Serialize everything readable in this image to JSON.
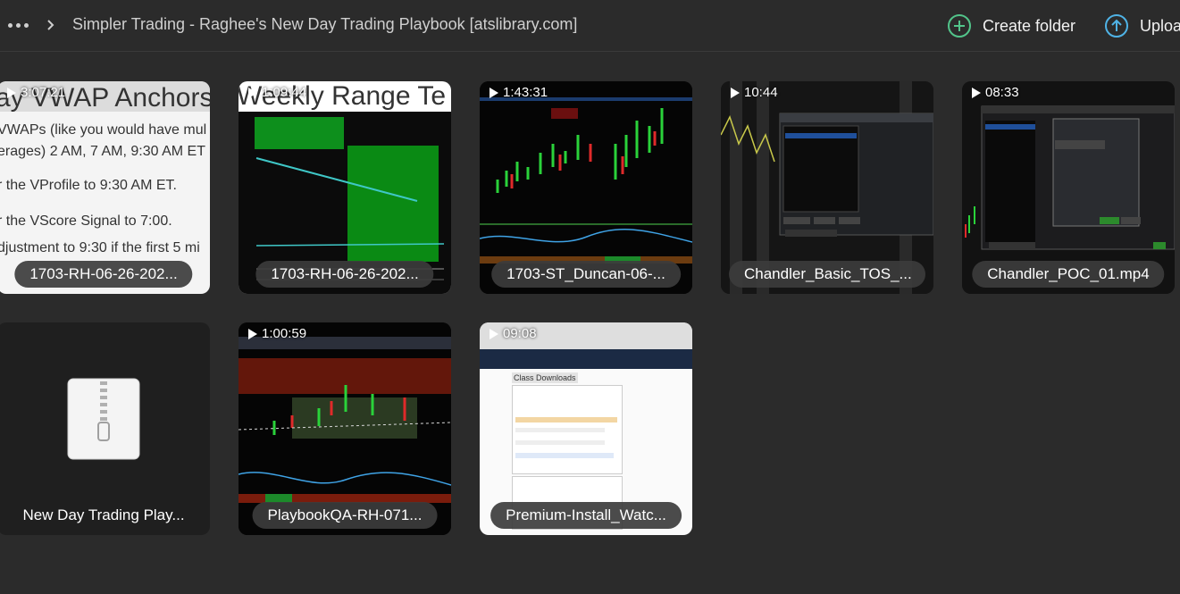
{
  "breadcrumb": {
    "title": "Simpler Trading - Raghee's New Day Trading Playbook [atslibrary.com]"
  },
  "actions": {
    "create_folder": "Create folder",
    "upload": "Uploa"
  },
  "colors": {
    "accent": "#4fb3e6",
    "create_folder_icon": "#52c48a",
    "background": "#2b2b2b"
  },
  "items": [
    {
      "name": "1703-RH-06-26-202...",
      "duration": "3:07:21",
      "type": "video"
    },
    {
      "name": "1703-RH-06-26-202...",
      "duration": "1:09:44",
      "type": "video"
    },
    {
      "name": "1703-ST_Duncan-06-...",
      "duration": "1:43:31",
      "type": "video"
    },
    {
      "name": "Chandler_Basic_TOS_...",
      "duration": "10:44",
      "type": "video"
    },
    {
      "name": "Chandler_POC_01.mp4",
      "duration": "08:33",
      "type": "video"
    },
    {
      "name": "New Day Trading Play...",
      "duration": "",
      "type": "zip",
      "icon": "zip-file-icon"
    },
    {
      "name": "PlaybookQA-RH-071...",
      "duration": "1:00:59",
      "type": "video"
    },
    {
      "name": "Premium-Install_Watc...",
      "duration": "09:08",
      "type": "video"
    }
  ],
  "thumb_text": {
    "t1_title": "ay VWAP Anchors",
    "t1_l1": "VWAPs (like you would have mul",
    "t1_l2": "erages) 2 AM, 7 AM, 9:30 AM ET",
    "t1_l3": "r the VProfile to 9:30 AM ET.",
    "t1_l4": "r the VScore Signal to 7:00.",
    "t1_l5": "djustment to 9:30 if the first 5 mi",
    "t2_title": "Weekly Range Te",
    "t8_header": "Class Downloads"
  }
}
